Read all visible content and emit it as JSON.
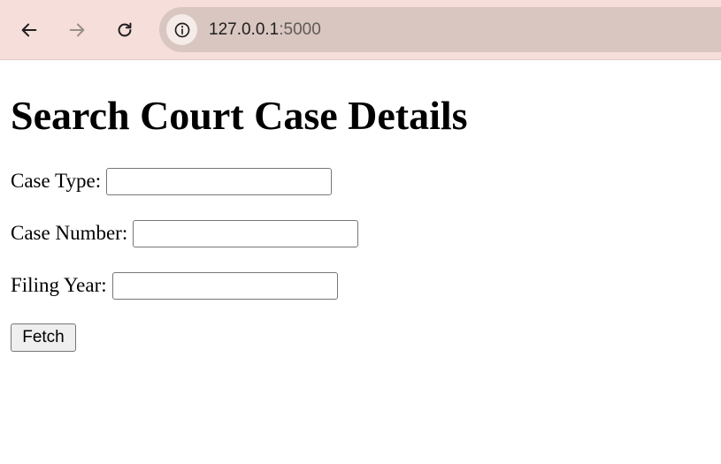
{
  "browser": {
    "url_host": "127.0.0.1",
    "url_port": ":5000",
    "icons": {
      "back": "arrow-left-icon",
      "forward": "arrow-right-icon",
      "reload": "reload-icon",
      "site_info": "info-icon"
    },
    "colors": {
      "toolbar": "#f6dedb",
      "address_bar": "#d9c6c0"
    }
  },
  "page": {
    "title": "Search Court Case Details",
    "form": {
      "case_type_label": "Case Type:",
      "case_type_value": "",
      "case_number_label": "Case Number:",
      "case_number_value": "",
      "filing_year_label": "Filing Year:",
      "filing_year_value": "",
      "submit_label": "Fetch"
    }
  }
}
